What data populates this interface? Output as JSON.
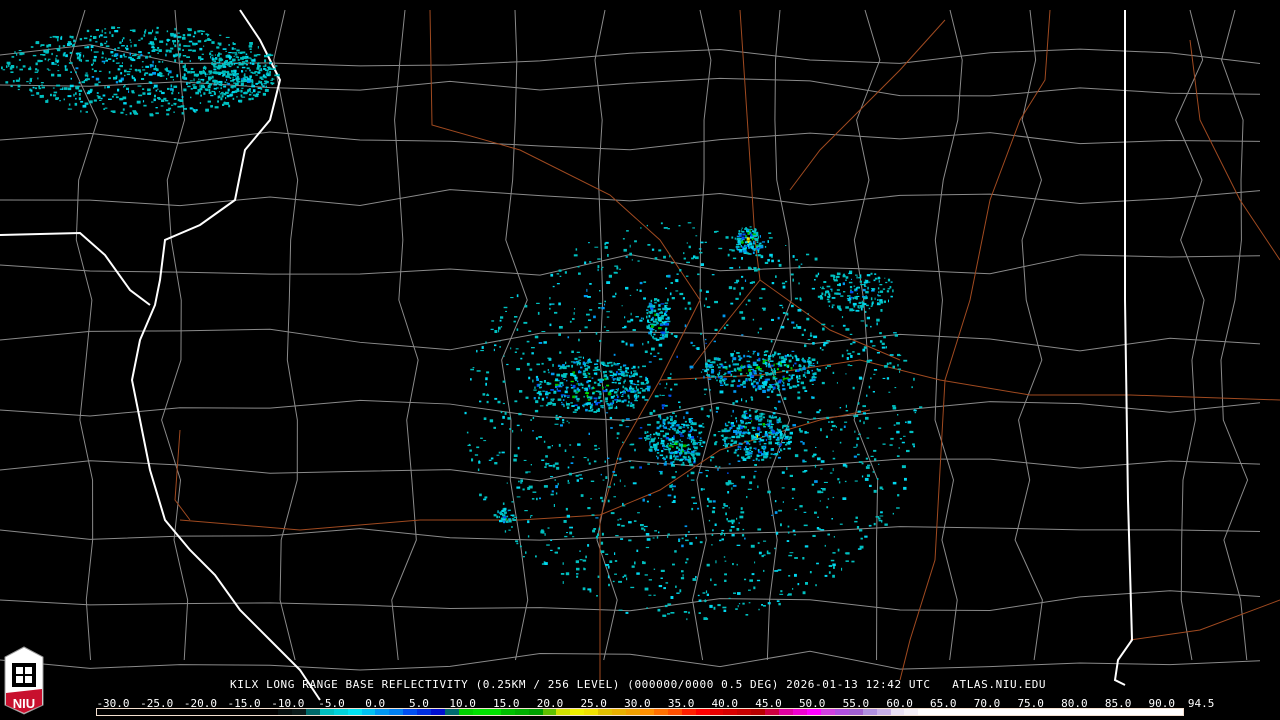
{
  "product": {
    "title": "KILX LONG RANGE BASE REFLECTIVITY (0.25KM / 256 LEVEL) (000000/0000 0.5 DEG) 2026-01-13 12:42 UTC   ATLAS.NIU.EDU"
  },
  "logo": {
    "text": "NIU"
  },
  "legend": {
    "labels": [
      "-30.0",
      "-25.0",
      "-20.0",
      "-15.0",
      "-10.0",
      "-5.0",
      "0.0",
      "5.0",
      "10.0",
      "15.0",
      "20.0",
      "25.0",
      "30.0",
      "35.0",
      "40.0",
      "45.0",
      "50.0",
      "55.0",
      "60.0",
      "65.0",
      "70.0",
      "75.0",
      "80.0",
      "85.0",
      "90.0",
      "94.5"
    ],
    "colors": [
      "#000000",
      "#000000",
      "#000000",
      "#000000",
      "#000000",
      "#000000",
      "#000000",
      "#000000",
      "#000000",
      "#000000",
      "#000000",
      "#000000",
      "#000000",
      "#050f0f",
      "#0a1a1a",
      "#006a6a",
      "#00c0c0",
      "#00d0d8",
      "#00e0f0",
      "#00c0f0",
      "#0098f0",
      "#0080f0",
      "#0050f0",
      "#0030e0",
      "#0010d0",
      "#006a70",
      "#00d000",
      "#00e000",
      "#00e000",
      "#00c000",
      "#00b000",
      "#00a000",
      "#60c000",
      "#d0e000",
      "#f0f000",
      "#f0e000",
      "#e0c000",
      "#e8b000",
      "#f0a000",
      "#ff9000",
      "#ff7000",
      "#ff5000",
      "#ff2000",
      "#ff0000",
      "#e80000",
      "#d80000",
      "#c80000",
      "#b80000",
      "#d00040",
      "#e000a0",
      "#f000d0",
      "#ff00ff",
      "#d040e0",
      "#b050e0",
      "#a060d0",
      "#b090e0",
      "#c8b0e8",
      "#e8e0f4",
      "#f4f0f8",
      "#ffffff",
      "#ffffff",
      "#ffffff",
      "#ffffff",
      "#ffffff",
      "#ffffff",
      "#ffffff",
      "#ffffff",
      "#ffffff",
      "#ffffff",
      "#ffffff",
      "#ffffff",
      "#ffffff",
      "#ffffff",
      "#ffffff",
      "#ffffff",
      "#ffffff",
      "#ffffff",
      "#ffffff"
    ]
  },
  "colors": {
    "county": "#8a8a8a",
    "state": "#ffffff",
    "highway": "#a04a20"
  }
}
